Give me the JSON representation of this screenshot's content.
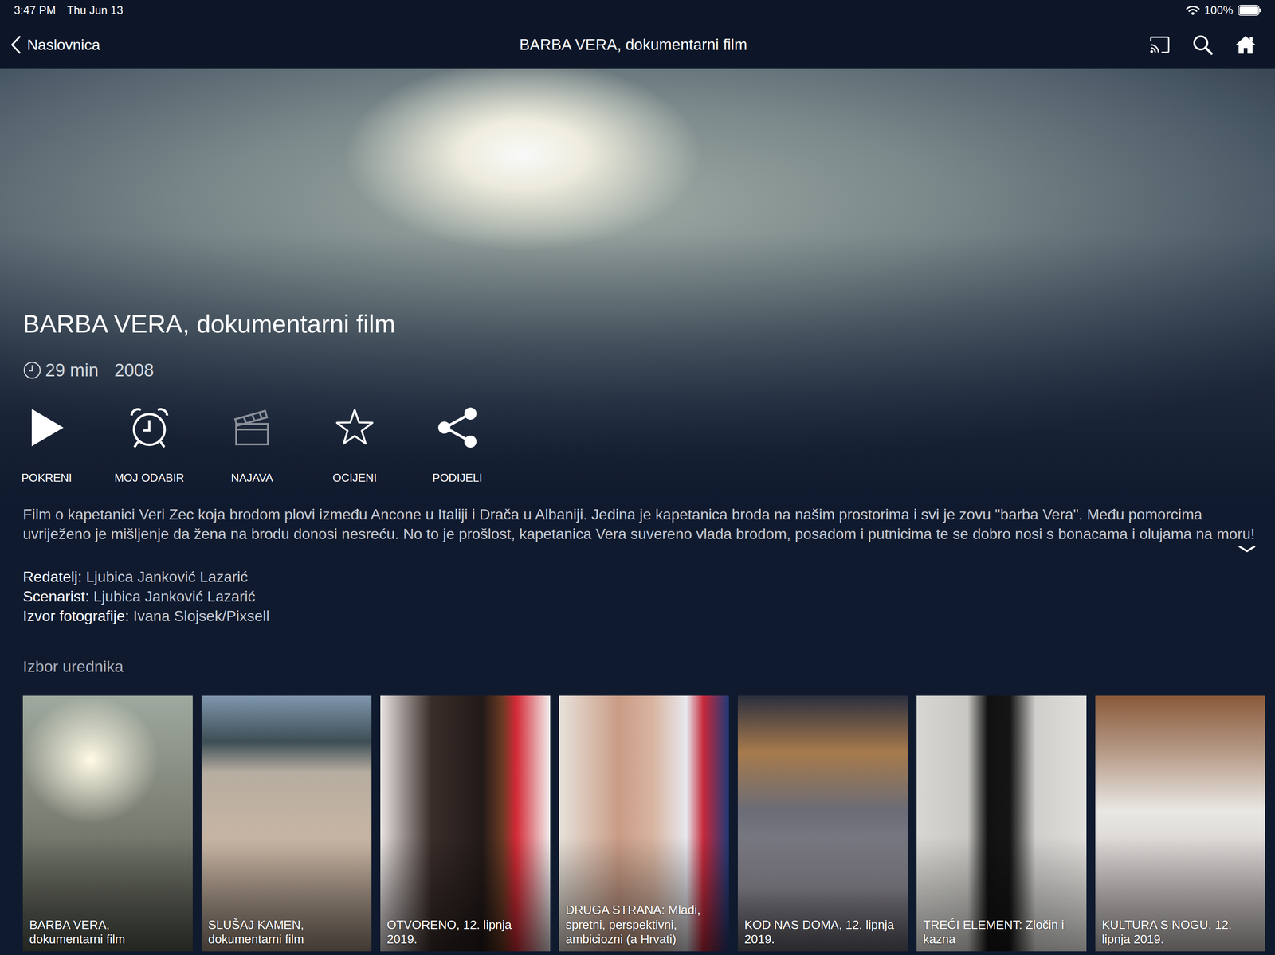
{
  "status_bar": {
    "time": "3:47 PM",
    "date": "Thu Jun 13",
    "battery": "100%",
    "battery_level": 1
  },
  "nav": {
    "back": "Naslovnica",
    "title": "BARBA VERA, dokumentarni film"
  },
  "hero": {
    "title": "BARBA VERA, dokumentarni film",
    "duration": "29 min",
    "year": "2008"
  },
  "actions": [
    {
      "label": "POKRENI",
      "disabled": false
    },
    {
      "label": "MOJ ODABIR",
      "disabled": false
    },
    {
      "label": "NAJAVA",
      "disabled": true
    },
    {
      "label": "OCIJENI",
      "disabled": false
    },
    {
      "label": "PODIJELI",
      "disabled": false
    }
  ],
  "description": {
    "text": "Film o kapetanici Veri Zec koja brodom plovi između Ancone u Italiji i Drača u Albaniji. Jedina je kapetanica broda na našim prostorima i svi je zovu \"barba Vera\". Među pomorcima uvriježeno je mišljenje da žena na brodu donosi nesreću. No to je prošlost, kapetanica Vera suvereno vlada brodom, posadom i putnicima te se dobro nosi s bonacama i olujama na moru!",
    "expanded": false
  },
  "credits": [
    {
      "label": "Redatelj:",
      "value": "Ljubica Janković Lazarić"
    },
    {
      "label": "Scenarist:",
      "value": "Ljubica Janković Lazarić"
    },
    {
      "label": "Izvor fotografije:",
      "value": "Ivana Slojsek/Pixsell"
    }
  ],
  "editors_pick": {
    "title": "Izbor urednika",
    "items": [
      {
        "caption": "BARBA VERA, dokumentarni film"
      },
      {
        "caption": "SLUŠAJ KAMEN, dokumentarni film"
      },
      {
        "caption": "OTVORENO, 12. lipnja 2019."
      },
      {
        "caption": "DRUGA STRANA: Mladi, spretni, perspektivni, ambiciozni (a Hrvati)"
      },
      {
        "caption": "KOD NAS DOMA, 12. lipnja 2019."
      },
      {
        "caption": "TREĆI ELEMENT: Zločin i kazna"
      },
      {
        "caption": "KULTURA S NOGU, 12. lipnja 2019."
      }
    ]
  }
}
